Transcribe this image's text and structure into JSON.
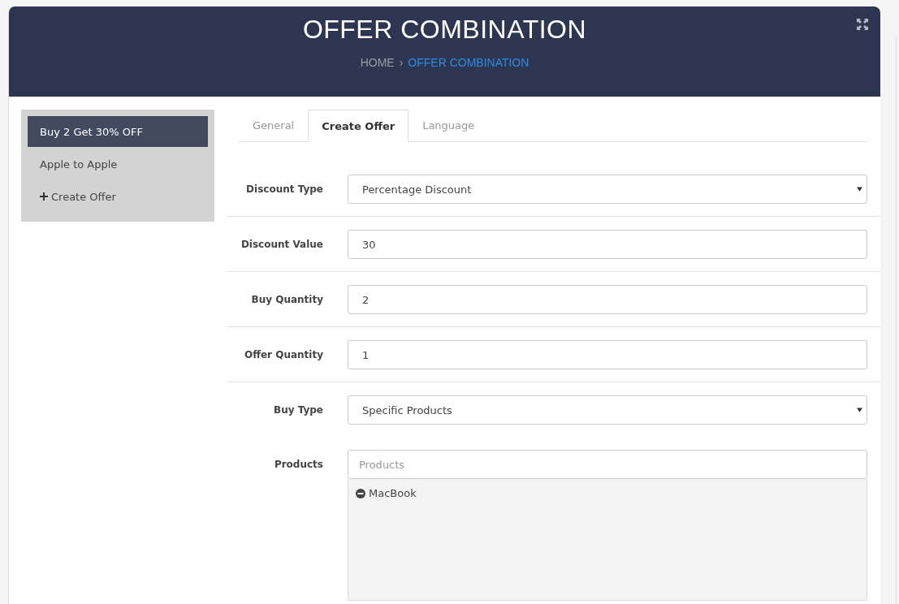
{
  "header": {
    "title": "OFFER COMBINATION",
    "separator": "›",
    "breadcrumb": [
      {
        "label": "HOME",
        "selected": false
      },
      {
        "label": "OFFER COMBINATION",
        "selected": true
      }
    ]
  },
  "sidebar": {
    "items": [
      {
        "label": "Buy 2 Get 30% OFF",
        "kind": "offer",
        "selected": true
      },
      {
        "label": "Apple to Apple",
        "kind": "offer",
        "selected": false
      },
      {
        "label": "Create Offer",
        "kind": "add",
        "selected": false
      }
    ]
  },
  "tabs": [
    {
      "label": "General",
      "selected": false
    },
    {
      "label": "Create Offer",
      "selected": true
    },
    {
      "label": "Language",
      "selected": false
    }
  ],
  "form": {
    "ruled_fields": [
      {
        "label": "Discount Type",
        "kind": "select",
        "value": "Percentage Discount"
      },
      {
        "label": "Discount Value",
        "kind": "input",
        "value": "30"
      },
      {
        "label": "Buy Quantity",
        "kind": "input",
        "value": "2"
      },
      {
        "label": "Offer Quantity",
        "kind": "input",
        "value": "1"
      }
    ],
    "product_fields": [
      {
        "label": "Buy Type",
        "kind": "select",
        "value": "Specific Products"
      },
      {
        "label": "Products",
        "kind": "products",
        "placeholder": "Products",
        "items": [
          "MacBook"
        ]
      }
    ]
  }
}
